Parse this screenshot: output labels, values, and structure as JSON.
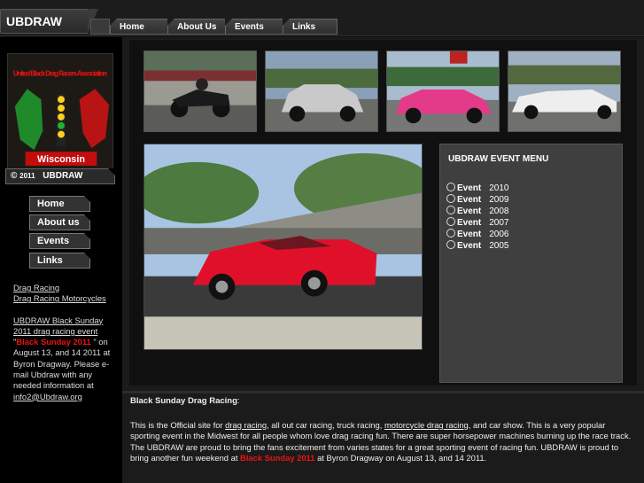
{
  "site": {
    "title": "UBDRAW"
  },
  "nav": {
    "items": [
      {
        "label": "Home"
      },
      {
        "label": "About Us"
      },
      {
        "label": "Events"
      },
      {
        "label": "Links"
      }
    ]
  },
  "logo": {
    "top_text": "United Black Drag Racers Association",
    "bottom_text": "Wisconsin"
  },
  "sidebar": {
    "copyright_symbol": "©",
    "copyright_year": "2011",
    "copyright_name": "UBDRAW",
    "buttons": [
      {
        "label": "Home"
      },
      {
        "label": "About us"
      },
      {
        "label": "Events"
      },
      {
        "label": "Links"
      }
    ],
    "link1": "Drag Racing",
    "link2": "Drag Racing Motorcycles",
    "event_link": "UBDRAW Black Sunday 2011 drag racing event",
    "quote_open": " \"",
    "event_name": "Black Sunday 2011",
    "quote_close": " \"",
    "info": " on August 13, and 14 2011 at Byron Dragway. Please e-mail Ubdraw with any needed information at ",
    "email": "info2@Ubdraw.org"
  },
  "event_menu": {
    "title": "UBDRAW EVENT MENU",
    "items": [
      {
        "label": "Event",
        "year": "2010"
      },
      {
        "label": "Event",
        "year": "2009"
      },
      {
        "label": "Event",
        "year": "2008"
      },
      {
        "label": "Event",
        "year": "2007"
      },
      {
        "label": "Event",
        "year": "2006"
      },
      {
        "label": "Event",
        "year": "2005"
      }
    ]
  },
  "content": {
    "heading": "Black Sunday Drag Racing",
    "heading_suffix": ":",
    "p1": "This is the Official site for ",
    "link_drag": "drag racing",
    "p2": ", all out car racing, truck racing, ",
    "link_moto": "motorcycle drag racing",
    "p3": ", and car show. This is a very popular sporting event in the Midwest for all people whom love drag racing fun. There are super horsepower machines burning up the race track. The UBDRAW are proud to bring the fans excitement from varies states for a great sporting event of racing fun. UBDRAW is proud to bring another fun weekend at ",
    "event_name": "Black Sunday 2011",
    "p4": " at Byron Dragway on August 13, and 14 2011."
  },
  "colors": {
    "accent_red": "#e11",
    "menu_bg": "#3f3f3f",
    "hero_car": "#e0102a"
  }
}
